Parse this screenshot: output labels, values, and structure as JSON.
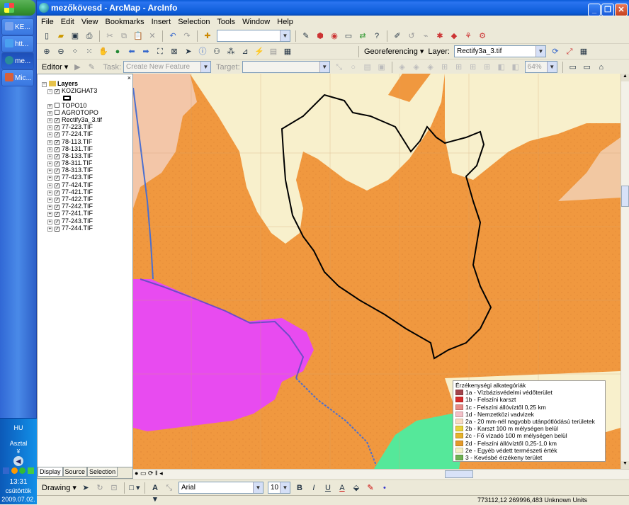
{
  "taskbar": {
    "start_label": "",
    "buttons": [
      {
        "label": "KE...",
        "color": "#5a8be6"
      },
      {
        "label": "htt...",
        "color": "#2d7ae0"
      },
      {
        "label": "me...",
        "color": "#2a8c9a"
      },
      {
        "label": "Mic...",
        "color": "#c8502a"
      }
    ],
    "lang": "HU",
    "desktop": "Asztal",
    "time": "13:31",
    "day": "csütörtök",
    "date": "2009.07.02."
  },
  "window": {
    "title": "mezőkövesd - ArcMap - ArcInfo"
  },
  "menu": [
    "File",
    "Edit",
    "View",
    "Bookmarks",
    "Insert",
    "Selection",
    "Tools",
    "Window",
    "Help"
  ],
  "georef": {
    "label": "Georeferencing ▾",
    "layer_label": "Layer:",
    "layer_value": "Rectify3a_3.tif"
  },
  "editor": {
    "label": "Editor ▾",
    "task_label": "Task:",
    "task_value": "Create New Feature",
    "target_label": "Target:",
    "zoom_value": "64%"
  },
  "toc": {
    "root": "Layers",
    "layers": [
      {
        "name": "KOZIGHAT3",
        "checked": true,
        "expanded": true
      },
      {
        "name": "TOPO10",
        "checked": false
      },
      {
        "name": "AGROTOPO",
        "checked": false
      },
      {
        "name": "Rectify3a_3.tif",
        "checked": true
      },
      {
        "name": "77-223.TIF",
        "checked": true
      },
      {
        "name": "77-224.TIF",
        "checked": true
      },
      {
        "name": "78-113.TIF",
        "checked": true
      },
      {
        "name": "78-131.TIF",
        "checked": true
      },
      {
        "name": "78-133.TIF",
        "checked": true
      },
      {
        "name": "78-311.TIF",
        "checked": true
      },
      {
        "name": "78-313.TIF",
        "checked": true
      },
      {
        "name": "77-423.TIF",
        "checked": true
      },
      {
        "name": "77-424.TIF",
        "checked": true
      },
      {
        "name": "77-421.TIF",
        "checked": true
      },
      {
        "name": "77-422.TIF",
        "checked": true
      },
      {
        "name": "77-242.TIF",
        "checked": true
      },
      {
        "name": "77-241.TIF",
        "checked": true
      },
      {
        "name": "77-243.TIF",
        "checked": true
      },
      {
        "name": "77-244.TIF",
        "checked": true
      }
    ],
    "tabs": [
      "Display",
      "Source",
      "Selection"
    ]
  },
  "legend": {
    "title": "Érzékenységi alkategóriák",
    "items": [
      {
        "label": "1a - Vízbázisvédelmi védőterület",
        "color": "#a3434a"
      },
      {
        "label": "1b - Felszíni karszt",
        "color": "#d62b2b"
      },
      {
        "label": "1c - Felszíni állóvíztől 0,25 km",
        "color": "#e88a86"
      },
      {
        "label": "1d - Nemzetközi vadvizek",
        "color": "#f4c0c8"
      },
      {
        "label": "2a - 20 mm-nél nagyobb utánpótlódású területek",
        "color": "#f8dcc2"
      },
      {
        "label": "2b - Karszt 100 m mélységen belül",
        "color": "#e8d23a"
      },
      {
        "label": "2c - Fő vízadó 100 m mélységen belül",
        "color": "#e6b22c"
      },
      {
        "label": "2d - Felszíni állóvíztől 0,25-1,0 km",
        "color": "#e49a2a"
      },
      {
        "label": "2e - Egyéb védett természeti érték",
        "color": "#f2f0c4"
      },
      {
        "label": "3 - Kevésbé érzékeny terület",
        "color": "#6fb253"
      }
    ]
  },
  "drawing": {
    "label": "Drawing ▾",
    "font": "Arial",
    "size": "10"
  },
  "status": {
    "coords": "773112,12  269996,483 Unknown Units"
  },
  "colors": {
    "map_orange": "#f0983f",
    "map_cream": "#f8f0cc",
    "map_pink": "#f3c6a8",
    "map_magenta": "#e84bf0",
    "map_green": "#55e89a"
  }
}
